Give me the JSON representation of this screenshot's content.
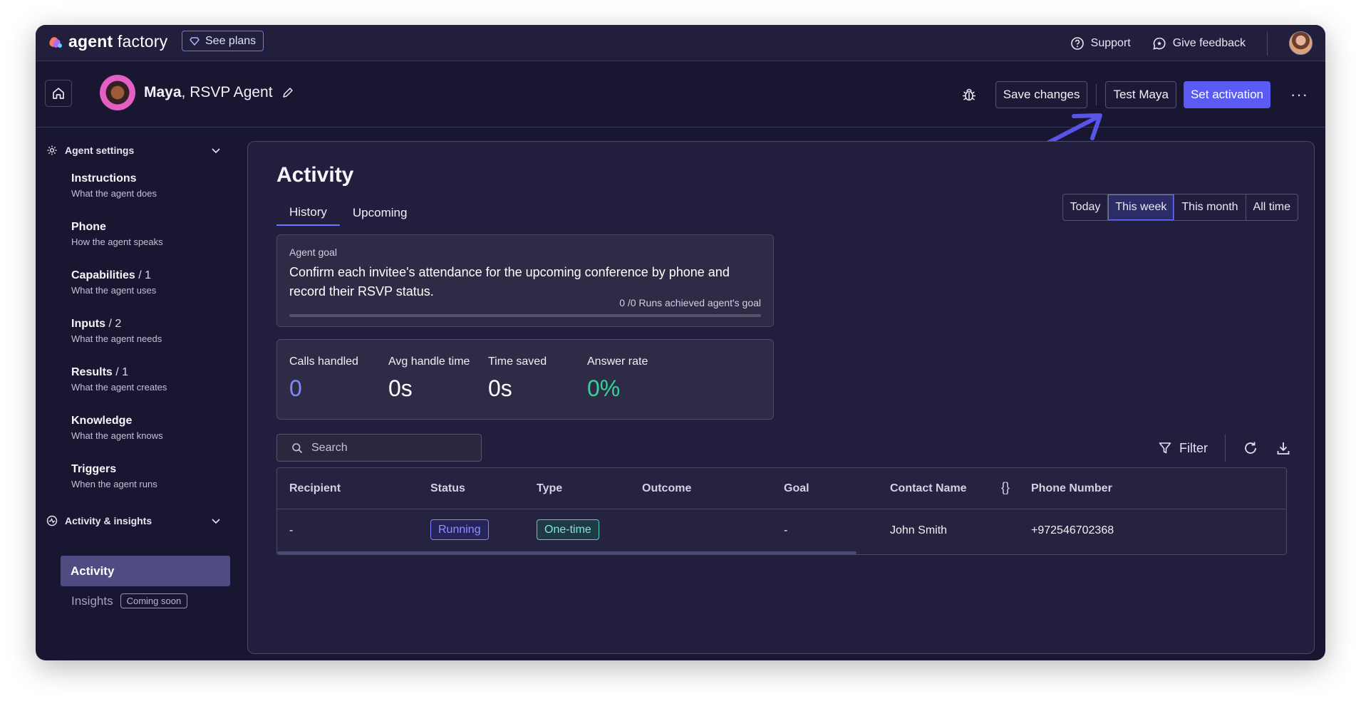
{
  "topbar": {
    "brand_bold": "agent",
    "brand_light": " factory",
    "plans_label": "See plans",
    "support_label": "Support",
    "feedback_label": "Give feedback"
  },
  "header": {
    "agent_name": "Maya",
    "agent_role": ", RSVP Agent",
    "save_label": "Save changes",
    "test_label": "Test Maya",
    "activation_label": "Set activation",
    "more_label": "···"
  },
  "sidebar": {
    "settings_title": "Agent settings",
    "items": [
      {
        "title": "Instructions",
        "count": "",
        "sub": "What the agent does"
      },
      {
        "title": "Phone",
        "count": "",
        "sub": "How the agent speaks"
      },
      {
        "title": "Capabilities",
        "count": "/ 1",
        "sub": "What the agent uses"
      },
      {
        "title": "Inputs",
        "count": "/ 2",
        "sub": "What the agent needs"
      },
      {
        "title": "Results",
        "count": "/ 1",
        "sub": "What the agent creates"
      },
      {
        "title": "Knowledge",
        "count": "",
        "sub": "What the agent knows"
      },
      {
        "title": "Triggers",
        "count": "",
        "sub": "When the agent runs"
      }
    ],
    "insights_title": "Activity & insights",
    "activity_label": "Activity",
    "insights_label": "Insights",
    "coming_soon": "Coming soon"
  },
  "main": {
    "title": "Activity",
    "tabs": [
      "History",
      "Upcoming"
    ],
    "active_tab": "History",
    "ranges": [
      "Today",
      "This week",
      "This month",
      "All time"
    ],
    "selected_range": "This week",
    "goal": {
      "label": "Agent goal",
      "text": "Confirm each invitee's attendance for the upcoming conference by phone and record their RSVP status.",
      "runs": "0 /0 Runs achieved agent's goal",
      "progress": 0
    },
    "stats": [
      {
        "label": "Calls handled",
        "value": "0",
        "color": "#7f8bff"
      },
      {
        "label": "Avg handle time",
        "value": "0s",
        "color": "#ffffff"
      },
      {
        "label": "Time saved",
        "value": "0s",
        "color": "#ffffff"
      },
      {
        "label": "Answer rate",
        "value": "0%",
        "color": "#34d399"
      }
    ],
    "search_placeholder": "Search",
    "filter_label": "Filter",
    "table": {
      "columns": [
        "Recipient",
        "Status",
        "Type",
        "Outcome",
        "Goal",
        "Contact Name",
        "{}",
        "Phone Number"
      ],
      "rows": [
        {
          "recipient": "-",
          "status": "Running",
          "type": "One-time",
          "outcome": "",
          "goal": "-",
          "contact_name": "John Smith",
          "phone_number": "+972546702368"
        }
      ]
    }
  },
  "colors": {
    "accent": "#5a5bf5",
    "running": "#7f85ff",
    "onetime": "#4fd1c5",
    "success": "#34d399",
    "arrow": "#5854e6"
  }
}
